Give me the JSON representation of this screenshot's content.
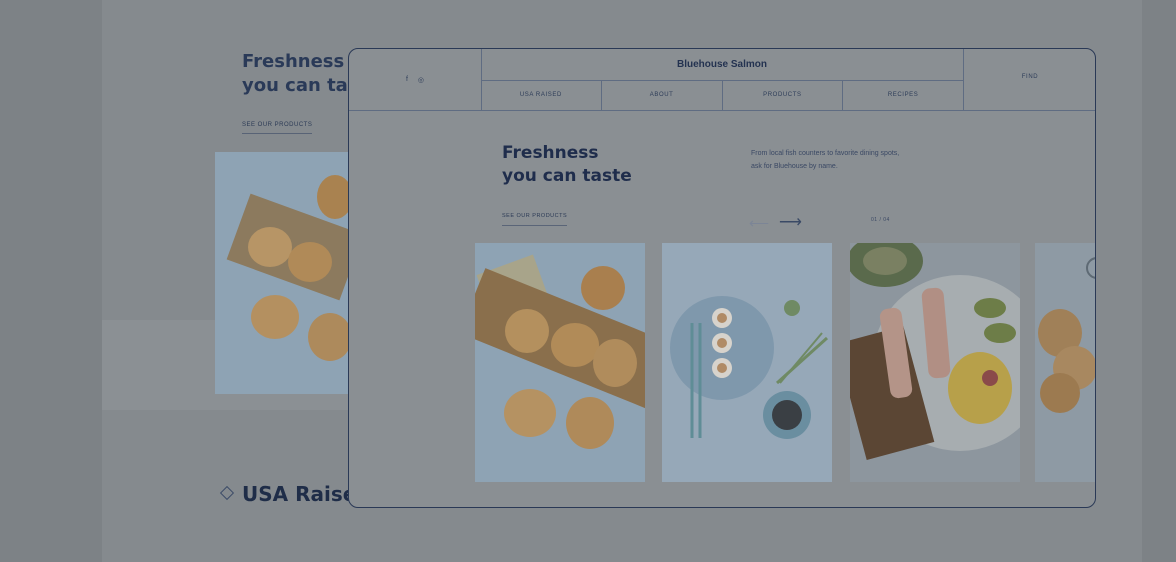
{
  "background_page": {
    "title": "Freshness\nyou can ta",
    "link_label": "SEE OUR PRODUCTS",
    "section_heading": "USA Raise"
  },
  "window": {
    "nav": {
      "social": {
        "facebook": "f",
        "instagram": "◎"
      },
      "brand": "Bluehouse Salmon",
      "menu": [
        "USA RAISED",
        "ABOUT",
        "PRODUCTS",
        "RECIPES"
      ],
      "find_label": "FIND"
    },
    "hero": {
      "title": "Freshness\nyou can taste",
      "description": "From local fish counters to favorite dining spots, ask for Bluehouse by name.",
      "link_label": "SEE OUR PRODUCTS",
      "counter": "01 / 04"
    },
    "carousel": {
      "slides": [
        "salmon-toast-photo",
        "sushi-photo",
        "salmon-skewers-photo",
        "toast-photo"
      ]
    }
  },
  "colors": {
    "navy": "#1f2d4c",
    "overlay": "#7d8286"
  },
  "icons": [
    "facebook-icon",
    "instagram-icon",
    "arrow-left-icon",
    "arrow-right-icon"
  ]
}
